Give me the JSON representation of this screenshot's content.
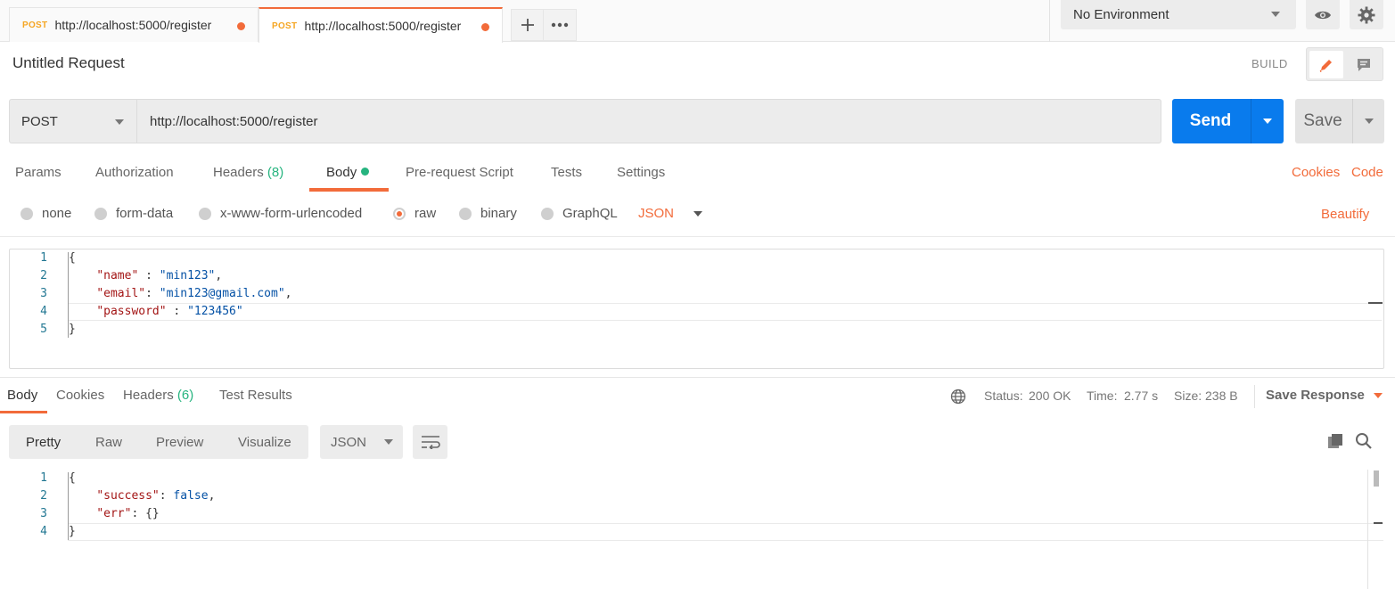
{
  "tabs": [
    {
      "method": "POST",
      "url": "http://localhost:5000/register"
    },
    {
      "method": "POST",
      "url": "http://localhost:5000/register"
    }
  ],
  "environment": {
    "selected": "No Environment"
  },
  "request": {
    "title": "Untitled Request",
    "build_label": "BUILD",
    "method": "POST",
    "url": "http://localhost:5000/register",
    "send_label": "Send",
    "save_label": "Save"
  },
  "request_tabs": {
    "params": "Params",
    "authorization": "Authorization",
    "headers": "Headers",
    "headers_count": "(8)",
    "body": "Body",
    "prerequest": "Pre-request Script",
    "tests": "Tests",
    "settings": "Settings",
    "cookies": "Cookies",
    "code": "Code"
  },
  "body_types": {
    "none": "none",
    "form_data": "form-data",
    "urlencoded": "x-www-form-urlencoded",
    "raw": "raw",
    "binary": "binary",
    "graphql": "GraphQL",
    "language": "JSON",
    "beautify": "Beautify"
  },
  "request_body": {
    "line_numbers": [
      "1",
      "2",
      "3",
      "4",
      "5"
    ],
    "open_brace": "{",
    "close_brace": "}",
    "fields": [
      {
        "key": "\"name\"",
        "sep": " : ",
        "value": "\"min123\"",
        "trail": ","
      },
      {
        "key": "\"email\"",
        "sep": ": ",
        "value": "\"min123@gmail.com\"",
        "trail": ","
      },
      {
        "key": "\"password\"",
        "sep": " : ",
        "value": "\"123456\"",
        "trail": ""
      }
    ]
  },
  "response_tabs": {
    "body": "Body",
    "cookies": "Cookies",
    "headers": "Headers",
    "headers_count": "(6)",
    "test_results": "Test Results"
  },
  "response_meta": {
    "status_label": "Status:",
    "status_value": "200 OK",
    "time_label": "Time:",
    "time_value": "2.77 s",
    "size_label": "Size:",
    "size_value": "238 B",
    "save_response": "Save Response"
  },
  "response_view": {
    "pretty": "Pretty",
    "raw": "Raw",
    "preview": "Preview",
    "visualize": "Visualize",
    "format": "JSON"
  },
  "response_body": {
    "line_numbers": [
      "1",
      "2",
      "3",
      "4"
    ],
    "open_brace": "{",
    "close_brace": "}",
    "fields": [
      {
        "key": "\"success\"",
        "sep": ": ",
        "value": "false",
        "trail": ","
      },
      {
        "key": "\"err\"",
        "sep": ": ",
        "value": "{}",
        "trail": ""
      }
    ]
  }
}
